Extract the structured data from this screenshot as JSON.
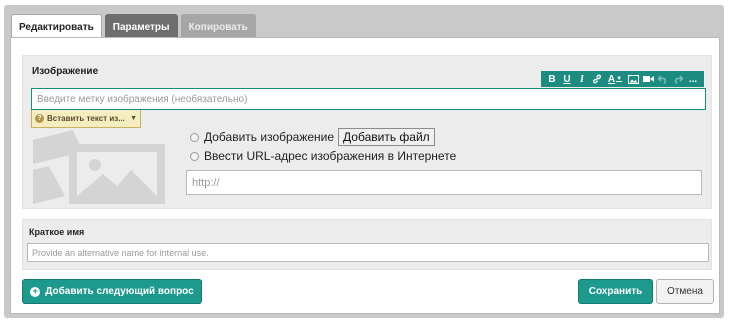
{
  "tabs": [
    {
      "label": "Редактировать",
      "state": "active"
    },
    {
      "label": "Параметры",
      "state": "inactive-dark"
    },
    {
      "label": "Копировать",
      "state": "inactive-light"
    }
  ],
  "image_section": {
    "label": "Изображение",
    "toolbar": {
      "bold": "B",
      "underline": "U",
      "italic": "I",
      "link_icon": "link-icon",
      "font_color": "A",
      "image_icon": "image-icon",
      "video_icon": "video-icon",
      "undo_icon": "undo-icon",
      "redo_icon": "redo-icon",
      "more": "..."
    },
    "label_input": {
      "value": "",
      "placeholder": "Введите метку изображения (необязательно)"
    },
    "insert_text_dropdown": {
      "label": "Вставить текст из..."
    },
    "add_image_option": {
      "label": "Добавить изображение",
      "button": "Добавить файл"
    },
    "url_option": {
      "label": "Ввести URL-адрес изображения в Интернете"
    },
    "url_input": {
      "value": "",
      "placeholder": "http://"
    }
  },
  "short_name": {
    "label": "Краткое имя",
    "input": {
      "value": "",
      "placeholder": "Provide an alternative name for internal use."
    }
  },
  "footer": {
    "add_next_label": "Добавить следующий вопрос",
    "save_label": "Сохранить",
    "cancel_label": "Отмена"
  },
  "colors": {
    "accent": "#1c9a8e",
    "toolbar": "#1c8c80",
    "frame": "#c9c9c9",
    "section_bg": "#ececec"
  }
}
